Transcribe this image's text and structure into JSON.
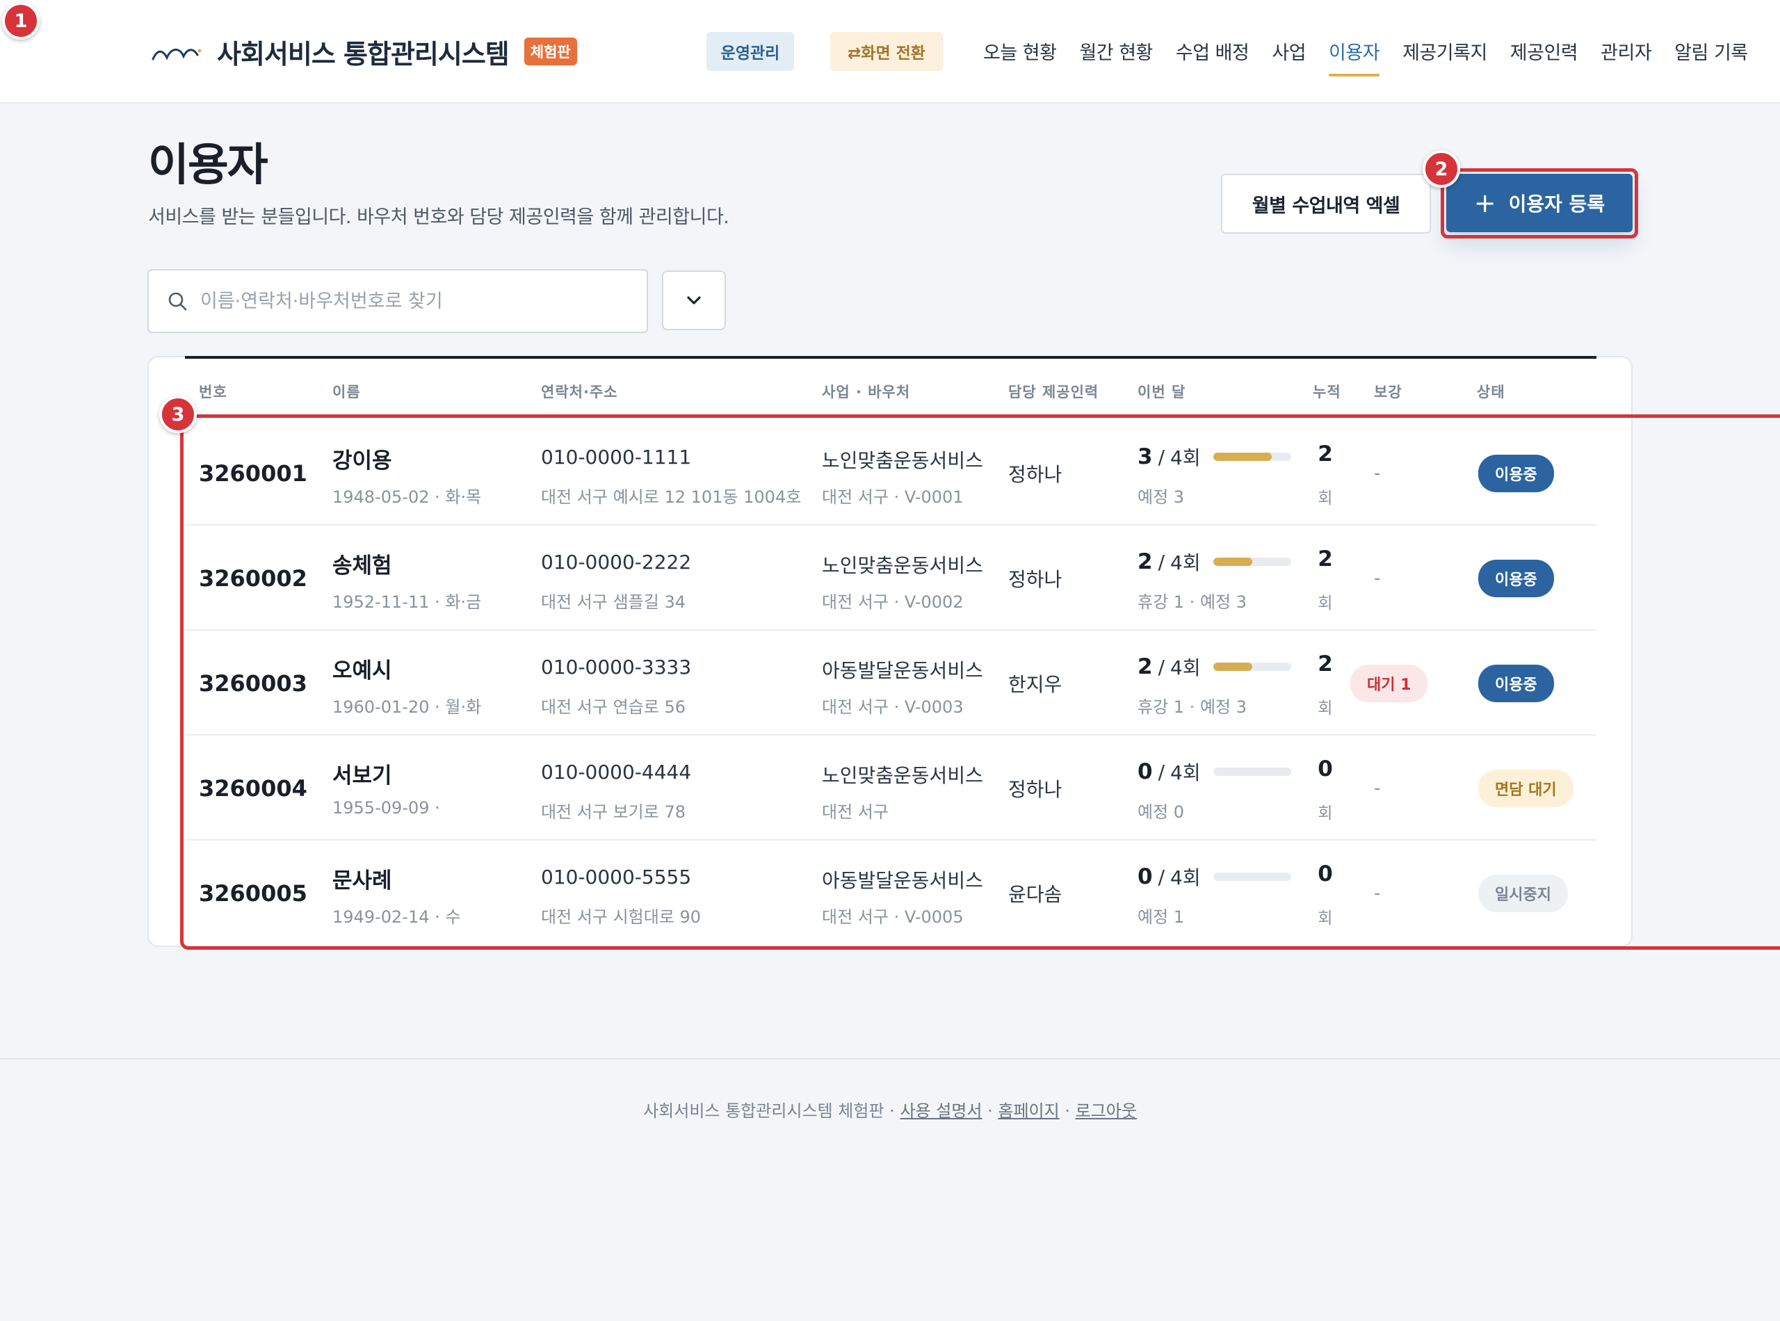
{
  "header": {
    "brand_title": "사회서비스 통합관리시스템",
    "brand_badge": "체험판",
    "ops_label": "운영관리",
    "switch_label": "⇄화면 전환",
    "nav": [
      "오늘 현황",
      "월간 현황",
      "수업 배정",
      "사업",
      "이용자",
      "제공기록지",
      "제공인력",
      "관리자",
      "알림 기록"
    ],
    "active_nav": "이용자"
  },
  "page": {
    "title": "이용자",
    "description": "서비스를 받는 분들입니다. 바우처 번호와 담당 제공인력을 함께 관리합니다.",
    "excel_button": "월별 수업내역 엑셀",
    "add_button": "이용자 등록",
    "add_icon": "plus-icon"
  },
  "filters": {
    "search_placeholder": "이름·연락처·바우처번호로 찾기",
    "search_value": "",
    "select_value": ""
  },
  "table": {
    "headers": {
      "no": "번호",
      "name": "이름",
      "contact": "연락처·주소",
      "program": "사업 · 바우처",
      "staff": "담당 제공인력",
      "month": "이번 달",
      "cumulative": "누적",
      "makeup": "보강",
      "status": "상태"
    },
    "rows": [
      {
        "no": "3260001",
        "name": "강이용",
        "birth": "1948-05-02 · 화·목",
        "phone": "010-0000-1111",
        "address": "대전 서구 예시로 12 101동 1004호",
        "program": "노인맞춤운동서비스",
        "voucher": "대전 서구 · V-0001",
        "staff": "정하나",
        "done": "3",
        "total": "4회",
        "progress": 0.75,
        "schedule": "예정 3",
        "cumulative": "2",
        "cumulative_unit": "회",
        "makeup": "-",
        "makeup_badge": "",
        "status": "이용중",
        "status_type": "active"
      },
      {
        "no": "3260002",
        "name": "송체험",
        "birth": "1952-11-11 · 화·금",
        "phone": "010-0000-2222",
        "address": "대전 서구 샘플길 34",
        "program": "노인맞춤운동서비스",
        "voucher": "대전 서구 · V-0002",
        "staff": "정하나",
        "done": "2",
        "total": "4회",
        "progress": 0.5,
        "schedule": "휴강 1 · 예정 3",
        "cumulative": "2",
        "cumulative_unit": "회",
        "makeup": "-",
        "makeup_badge": "",
        "status": "이용중",
        "status_type": "active"
      },
      {
        "no": "3260003",
        "name": "오예시",
        "birth": "1960-01-20 · 월·화",
        "phone": "010-0000-3333",
        "address": "대전 서구 연습로 56",
        "program": "아동발달운동서비스",
        "voucher": "대전 서구 · V-0003",
        "staff": "한지우",
        "done": "2",
        "total": "4회",
        "progress": 0.5,
        "schedule": "휴강 1 · 예정 3",
        "cumulative": "2",
        "cumulative_unit": "회",
        "makeup": "",
        "makeup_badge": "대기 1",
        "status": "이용중",
        "status_type": "active"
      },
      {
        "no": "3260004",
        "name": "서보기",
        "birth": "1955-09-09 ·",
        "phone": "010-0000-4444",
        "address": "대전 서구 보기로 78",
        "program": "노인맞춤운동서비스",
        "voucher": "대전 서구",
        "staff": "정하나",
        "done": "0",
        "total": "4회",
        "progress": 0,
        "schedule": "예정 0",
        "cumulative": "0",
        "cumulative_unit": "회",
        "makeup": "-",
        "makeup_badge": "",
        "status": "면담 대기",
        "status_type": "interview"
      },
      {
        "no": "3260005",
        "name": "문사례",
        "birth": "1949-02-14 · 수",
        "phone": "010-0000-5555",
        "address": "대전 서구 시험대로 90",
        "program": "아동발달운동서비스",
        "voucher": "대전 서구 · V-0005",
        "staff": "윤다솜",
        "done": "0",
        "total": "4회",
        "progress": 0,
        "schedule": "예정 1",
        "cumulative": "0",
        "cumulative_unit": "회",
        "makeup": "-",
        "makeup_badge": "",
        "status": "일시중지",
        "status_type": "pause"
      }
    ]
  },
  "footer": {
    "text": "사회서비스 통합관리시스템 체험판 · ",
    "links": [
      "사용 설명서",
      "홈페이지",
      "로그아웃"
    ],
    "sep": " · "
  },
  "markers": [
    "1",
    "2",
    "3"
  ],
  "colors": {
    "accent": "#2b64a0",
    "highlight": "#d6343a",
    "progress": "#d8ad52",
    "brand_badge": "#e8703a"
  }
}
